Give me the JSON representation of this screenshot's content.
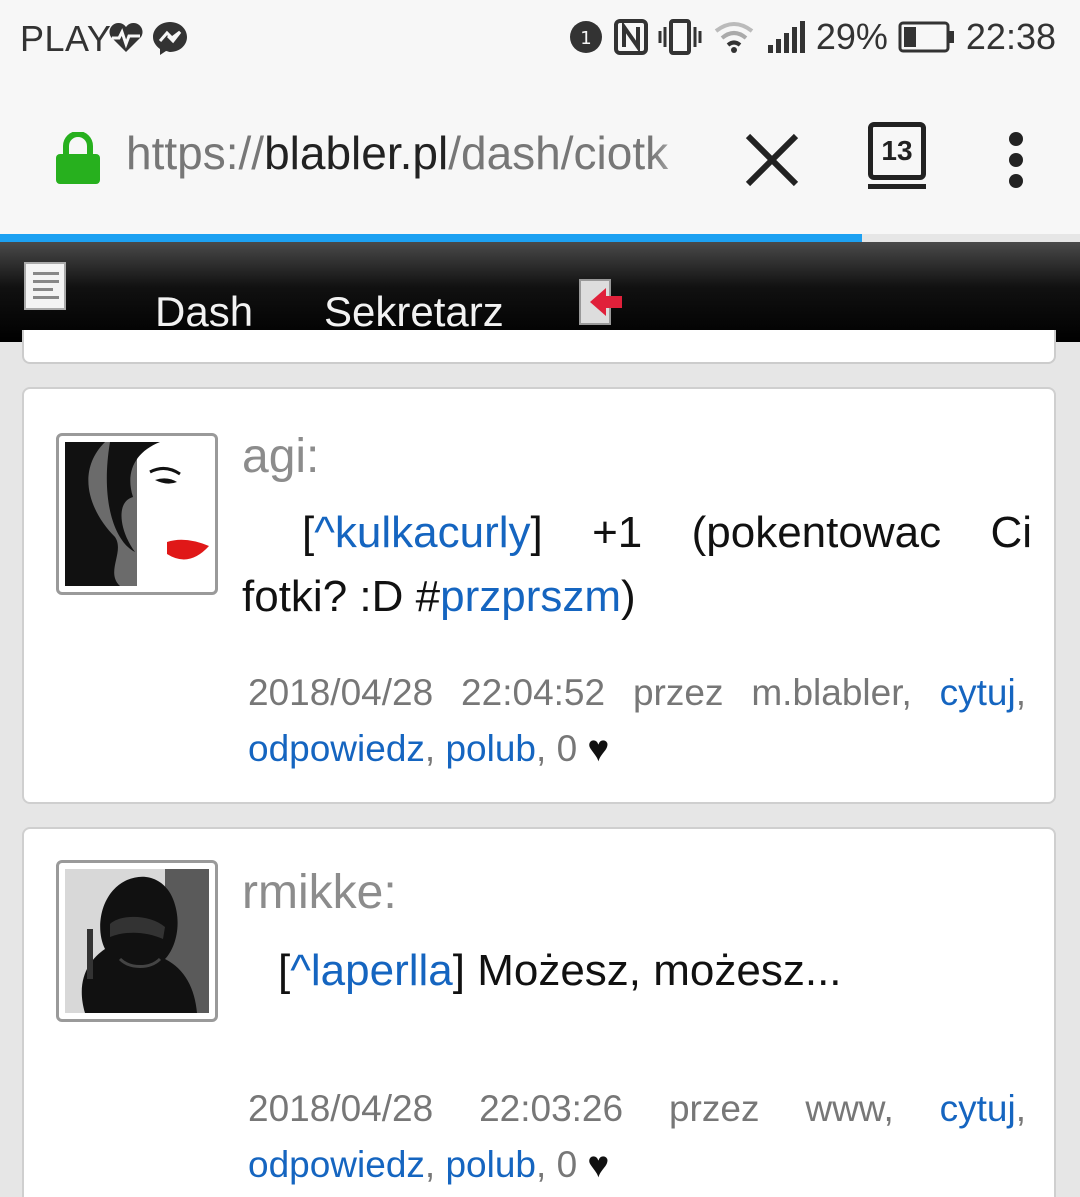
{
  "status_bar": {
    "carrier": "PLAY",
    "battery": "29%",
    "time": "22:38"
  },
  "browser": {
    "url_scheme": "https://",
    "url_host": "blabler.pl",
    "url_path": "/dash/ciotk",
    "tab_count": "13"
  },
  "nav": {
    "dash": "Dash",
    "sekretarz": "Sekretarz"
  },
  "posts": [
    {
      "author": "agi:",
      "reply_open": "[",
      "reply_user": "^kulkacurly",
      "reply_close": "]",
      "text_before": " +1 (pokentowac Ci fotki? :D #",
      "hashtag": "przprszm",
      "text_after": ")",
      "timestamp": "2018/04/28 22:04:52",
      "via": "przez m.blabler,",
      "quote": "cytuj",
      "reply": "odpowiedz",
      "like": "polub",
      "likes": "0",
      "heart": "♥"
    },
    {
      "author": "rmikke:",
      "reply_open": "[",
      "reply_user": "^laperlla",
      "reply_close": "]",
      "text_before": " Możesz, możesz...",
      "timestamp": "2018/04/28 22:03:26",
      "via": "przez www,",
      "quote": "cytuj",
      "reply": "odpowiedz",
      "like": "polub",
      "likes": "0",
      "heart": "♥"
    }
  ]
}
